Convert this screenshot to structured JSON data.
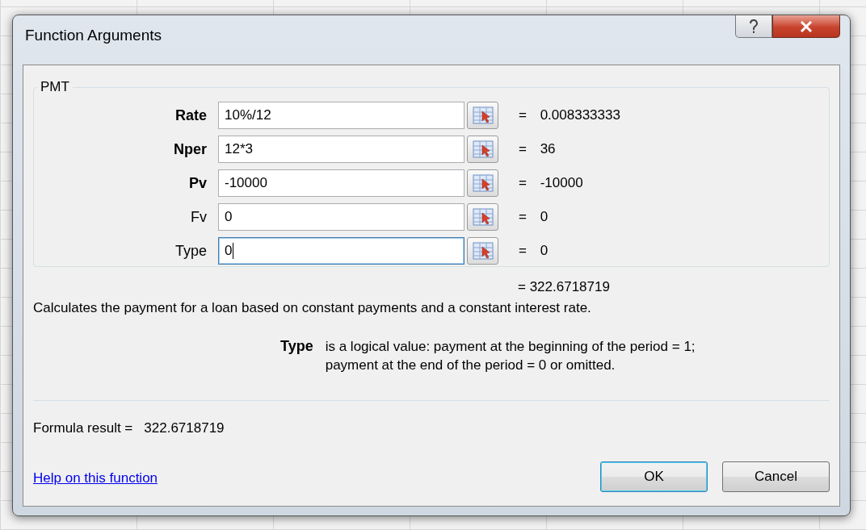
{
  "window": {
    "title": "Function Arguments"
  },
  "function": {
    "name": "PMT",
    "result": "= 322.6718719",
    "description": "Calculates the payment for a loan based on constant payments and a constant interest rate."
  },
  "arguments": [
    {
      "label": "Rate",
      "required": true,
      "value": "10%/12",
      "result": "= 0.008333333",
      "focused": false
    },
    {
      "label": "Nper",
      "required": true,
      "value": "12*3",
      "result": "= 36",
      "focused": false
    },
    {
      "label": "Pv",
      "required": true,
      "value": "-10000",
      "result": "= -10000",
      "focused": false
    },
    {
      "label": "Fv",
      "required": false,
      "value": "0",
      "result": "= 0",
      "focused": false
    },
    {
      "label": "Type",
      "required": false,
      "value": "0",
      "result": "= 0",
      "focused": true
    }
  ],
  "argument_help": {
    "name": "Type",
    "text": "is a logical value: payment at the beginning of the period = 1; payment at the end of the period = 0 or omitted."
  },
  "formula_result": {
    "label": "Formula result =",
    "value": "322.6718719"
  },
  "help_link": "Help on this function",
  "buttons": [
    {
      "label": "OK",
      "default": true
    },
    {
      "label": "Cancel",
      "default": false
    }
  ]
}
